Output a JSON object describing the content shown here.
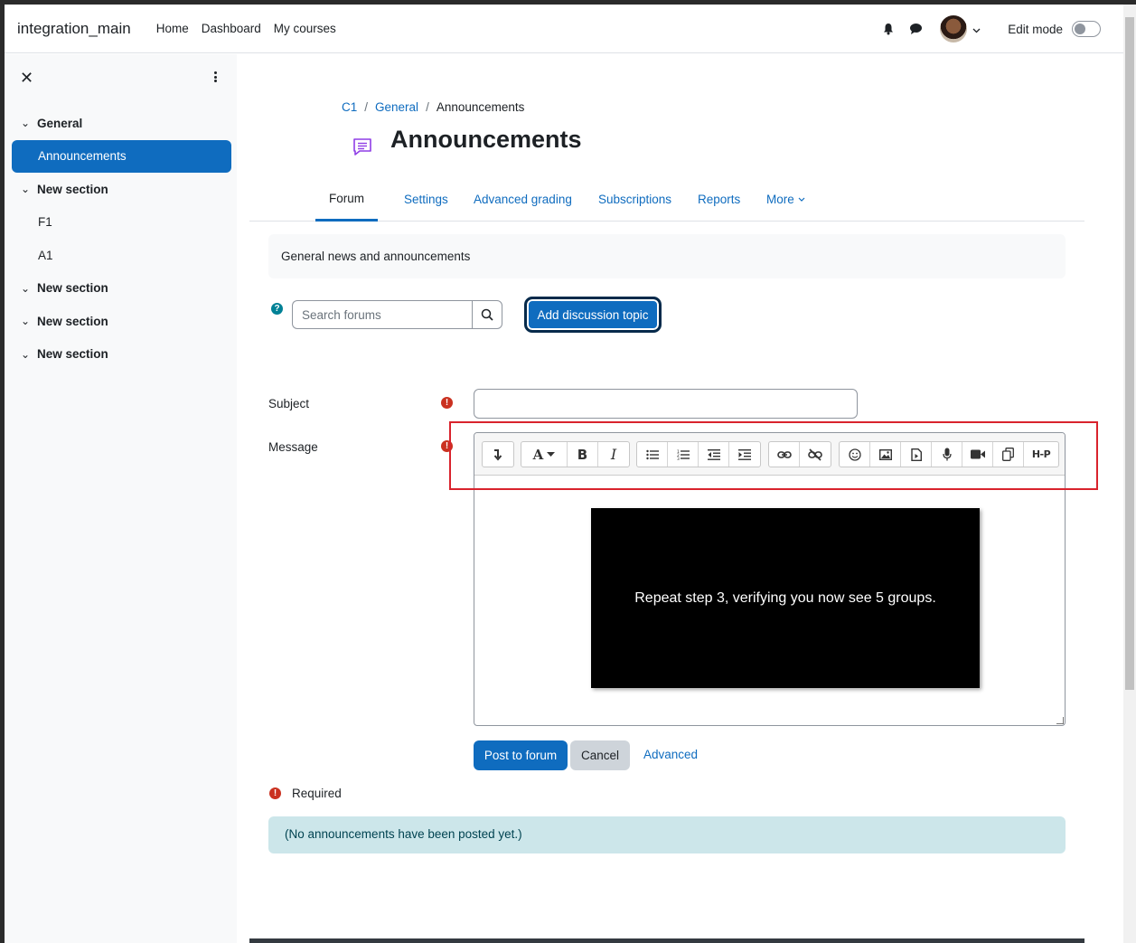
{
  "navbar": {
    "site_name": "integration_main",
    "links": [
      "Home",
      "Dashboard",
      "My courses"
    ],
    "edit_mode_label": "Edit mode"
  },
  "drawer": {
    "sections": [
      {
        "title": "General",
        "items": [
          "Announcements"
        ]
      },
      {
        "title": "New section",
        "items": [
          "F1",
          "A1"
        ]
      },
      {
        "title": "New section",
        "items": []
      },
      {
        "title": "New section",
        "items": []
      },
      {
        "title": "New section",
        "items": []
      }
    ],
    "active_item": "Announcements"
  },
  "breadcrumb": [
    "C1",
    "General",
    "Announcements"
  ],
  "page_title": "Announcements",
  "tabs": [
    "Forum",
    "Settings",
    "Advanced grading",
    "Subscriptions",
    "Reports",
    "More"
  ],
  "active_tab": "Forum",
  "intro_text": "General news and announcements",
  "search": {
    "placeholder": "Search forums"
  },
  "add_topic_label": "Add discussion topic",
  "form": {
    "subject_label": "Subject",
    "message_label": "Message",
    "video_caption": "Repeat step 3, verifying you now see 5 groups.",
    "post_label": "Post to forum",
    "cancel_label": "Cancel",
    "advanced_label": "Advanced",
    "required_label": "Required"
  },
  "toolbar_icons": [
    "insert-icon",
    "font-color-icon",
    "bold-icon",
    "italic-icon",
    "unordered-list-icon",
    "ordered-list-icon",
    "outdent-icon",
    "indent-icon",
    "link-icon",
    "unlink-icon",
    "emoji-icon",
    "image-icon",
    "media-icon",
    "record-audio-icon",
    "record-video-icon",
    "manage-files-icon",
    "h5p-icon"
  ],
  "h5p_label": "H-P",
  "notice_text": "(No announcements have been posted yet.)",
  "colors": {
    "primary": "#0f6cbf",
    "highlight": "#d9232d",
    "required": "#ca3120",
    "info": "#008196"
  }
}
